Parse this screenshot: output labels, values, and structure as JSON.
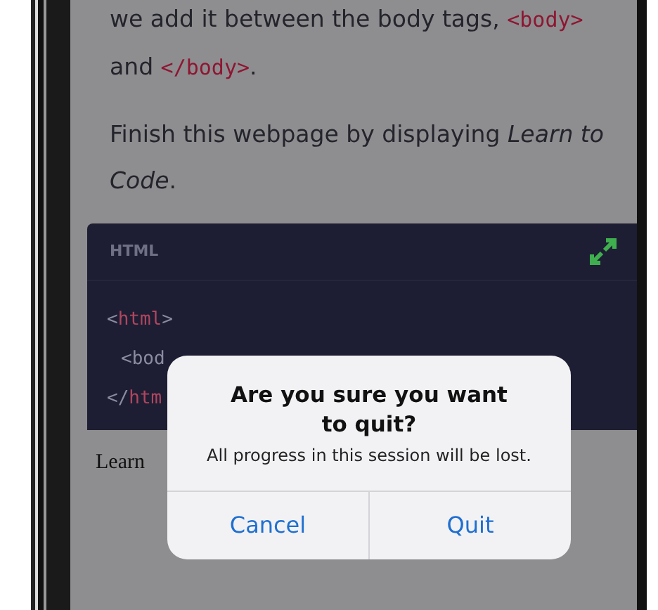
{
  "lesson": {
    "paragraphs": [
      [
        {
          "kind": "text",
          "text": "we add it between the body tags, "
        },
        {
          "kind": "code",
          "text": "<body>"
        },
        {
          "kind": "text",
          "text": " and "
        },
        {
          "kind": "code",
          "text": "</body>"
        },
        {
          "kind": "text",
          "text": "."
        }
      ],
      [
        {
          "kind": "text",
          "text": "Finish this webpage by displaying *Learn to Code*."
        }
      ]
    ]
  },
  "code_editor": {
    "language": "HTML",
    "lines": [
      [
        {
          "kind": "punct",
          "text": "<"
        },
        {
          "kind": "tag",
          "text": "html"
        },
        {
          "kind": "punct",
          "text": ">"
        }
      ],
      [
        {
          "kind": "punct",
          "text": "<bod"
        }
      ],
      [
        {
          "kind": "punct",
          "text": "</"
        },
        {
          "kind": "tag",
          "text": "htm"
        }
      ]
    ]
  },
  "output": {
    "text": "Learn"
  },
  "dialog": {
    "title": "Are you sure you want to quit?",
    "message": "All progress in this session will be lost.",
    "buttons": [
      {
        "label": "Cancel"
      },
      {
        "label": "Quit"
      }
    ]
  }
}
